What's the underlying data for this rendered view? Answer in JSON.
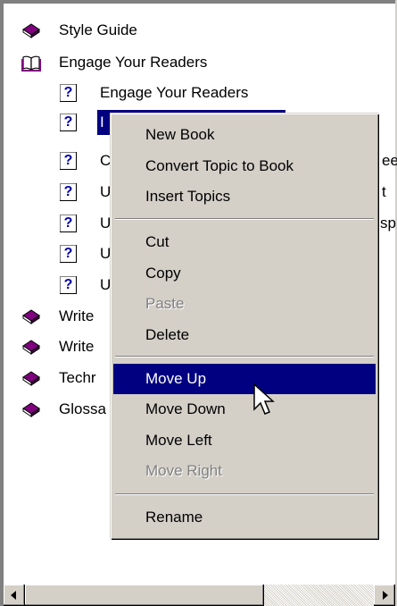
{
  "tree": {
    "items": [
      {
        "label": "Style Guide",
        "icon": "closed-book-icon"
      },
      {
        "label": "Engage Your Readers",
        "icon": "open-book-icon"
      },
      {
        "label": "Engage Your Readers",
        "icon": "help-topic-icon"
      },
      {
        "label": "I",
        "icon": "help-topic-icon",
        "selected": true
      },
      {
        "label": "C",
        "icon": "help-topic-icon"
      },
      {
        "label": "U",
        "icon": "help-topic-icon"
      },
      {
        "label": "U",
        "icon": "help-topic-icon"
      },
      {
        "label": "U",
        "icon": "help-topic-icon"
      },
      {
        "label": "U",
        "icon": "help-topic-icon"
      },
      {
        "label": "Write",
        "icon": "closed-book-icon"
      },
      {
        "label": "Write",
        "icon": "closed-book-icon"
      },
      {
        "label": "Techr",
        "icon": "closed-book-icon"
      },
      {
        "label": "Glossa",
        "icon": "closed-book-icon"
      }
    ],
    "peek_text": [
      "ee",
      "t",
      "sp"
    ],
    "help_glyph": "?"
  },
  "context_menu": {
    "items": [
      {
        "label": "New Book",
        "enabled": true
      },
      {
        "label": "Convert Topic to Book",
        "enabled": true
      },
      {
        "label": "Insert Topics",
        "enabled": true
      },
      {
        "label": "Cut",
        "enabled": true
      },
      {
        "label": "Copy",
        "enabled": true
      },
      {
        "label": "Paste",
        "enabled": false
      },
      {
        "label": "Delete",
        "enabled": true
      },
      {
        "label": "Move Up",
        "enabled": true,
        "highlighted": true
      },
      {
        "label": "Move Down",
        "enabled": true
      },
      {
        "label": "Move Left",
        "enabled": true
      },
      {
        "label": "Move Right",
        "enabled": false
      },
      {
        "label": "Rename",
        "enabled": true
      }
    ]
  },
  "colors": {
    "selection": "#000080",
    "menu_face": "#d4d0c8",
    "book_purple": "#800080",
    "help_blue": "#0000a0"
  }
}
